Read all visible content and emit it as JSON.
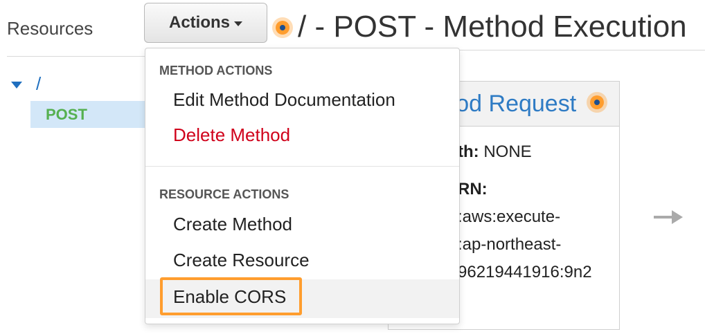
{
  "sidebar": {
    "title": "Resources",
    "root": "/",
    "method": "POST"
  },
  "toolbar": {
    "actions_label": "Actions"
  },
  "page": {
    "title": "/ - POST - Method Execution"
  },
  "method_request": {
    "title": "Method Request",
    "visible_title_fragment": "ethod Request",
    "auth_label": "th:",
    "auth_value": "NONE",
    "arn_label": "RN:",
    "arn_lines": [
      ":aws:execute-",
      ":ap-northeast-",
      "96219441916:9n2"
    ]
  },
  "dropdown": {
    "method_actions_heading": "METHOD ACTIONS",
    "method_actions": [
      "Edit Method Documentation",
      "Delete Method"
    ],
    "resource_actions_heading": "RESOURCE ACTIONS",
    "resource_actions": [
      "Create Method",
      "Create Resource",
      "Enable CORS"
    ]
  },
  "colors": {
    "accent": "#ff9d2e",
    "link": "#2e7bc4",
    "danger": "#d0021b",
    "method_green": "#55b050",
    "selected_bg": "#d3e7f8"
  }
}
